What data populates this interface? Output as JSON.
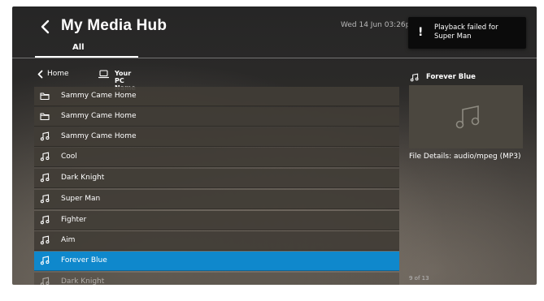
{
  "app": {
    "title": "My Media Hub",
    "datetime": "Wed 14 Jun 03:26p"
  },
  "tabs": [
    {
      "label": "All"
    }
  ],
  "toast": {
    "icon": "!",
    "message": "Playback failed for Super Man"
  },
  "breadcrumb": {
    "home": "Home",
    "device": "Your PC Name"
  },
  "list": {
    "items": [
      {
        "label": "Sammy Came Home",
        "icon": "folder-icon"
      },
      {
        "label": "Sammy Came Home",
        "icon": "folder-icon"
      },
      {
        "label": "Sammy Came Home",
        "icon": "music-note-icon"
      },
      {
        "label": "Cool",
        "icon": "music-note-icon"
      },
      {
        "label": "Dark Knight",
        "icon": "music-note-icon"
      },
      {
        "label": "Super Man",
        "icon": "music-note-icon"
      },
      {
        "label": "Fighter",
        "icon": "music-note-icon"
      },
      {
        "label": "Aim",
        "icon": "music-note-icon"
      },
      {
        "label": "Forever Blue",
        "icon": "music-note-icon",
        "selected": true
      },
      {
        "label": "Dark Knight",
        "icon": "music-note-icon"
      }
    ]
  },
  "details_panel": {
    "title": "Forever Blue",
    "file_details": "File Details: audio/mpeg (MP3)",
    "position": "9 of 13"
  },
  "colors": {
    "selection": "#0f88cc",
    "row": "#413c36",
    "toast_bg": "#0b0b0b"
  }
}
